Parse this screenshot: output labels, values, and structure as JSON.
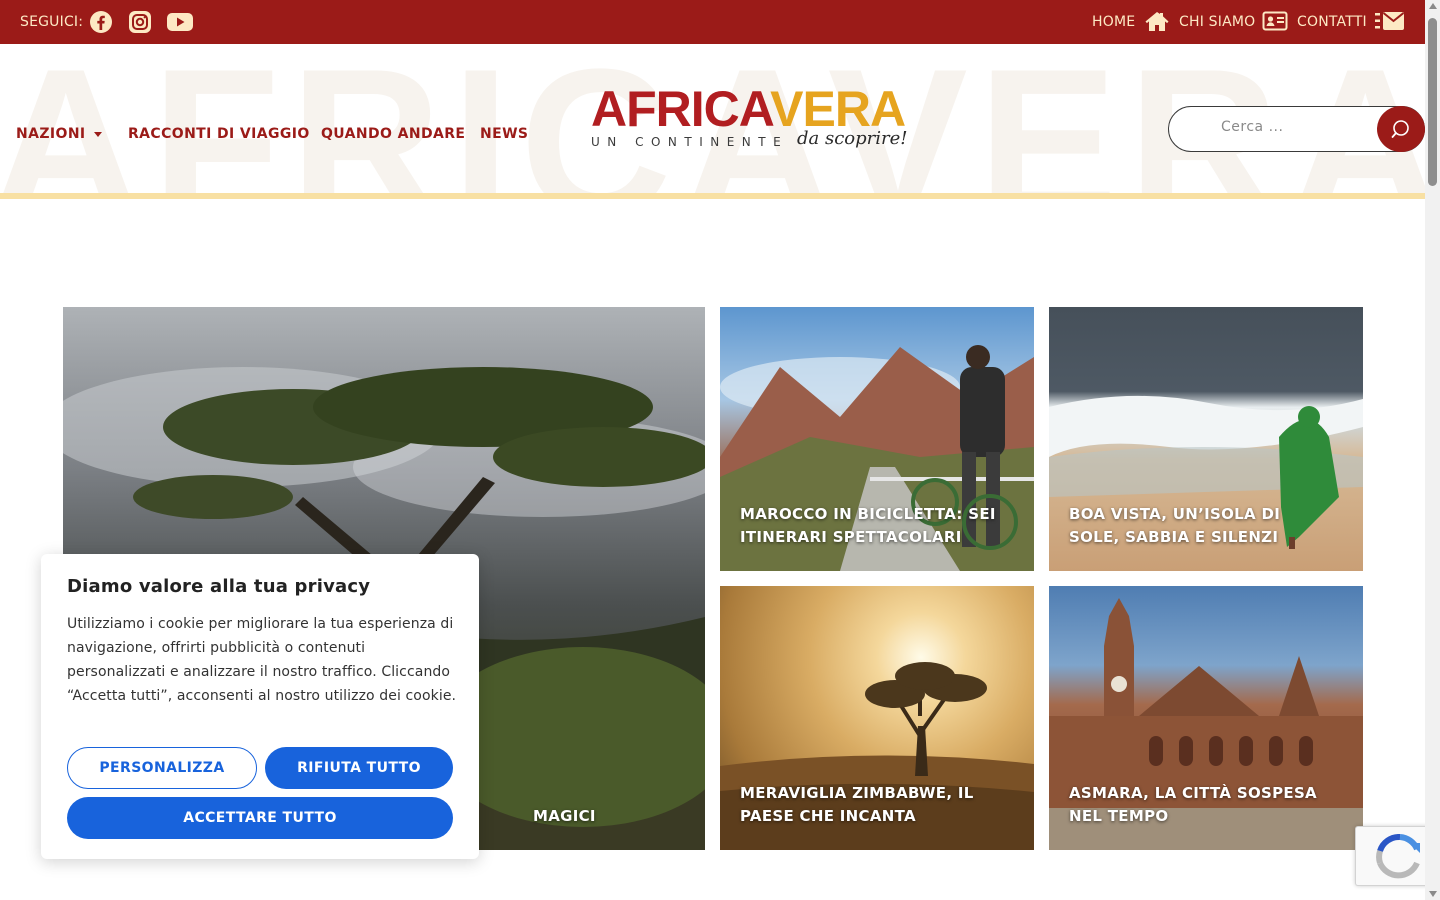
{
  "topbar": {
    "follow_label": "SEGUICI:",
    "social": [
      "facebook-icon",
      "instagram-icon",
      "youtube-icon"
    ],
    "links": [
      {
        "label": "HOME",
        "icon": "home-icon"
      },
      {
        "label": "CHI SIAMO",
        "icon": "id-card-icon"
      },
      {
        "label": "CONTATTI",
        "icon": "envelope-icon"
      }
    ]
  },
  "header": {
    "watermark": "AFRICAVERA AFRICAVERA",
    "nav": [
      {
        "label": "NAZIONI",
        "has_dropdown": true
      },
      {
        "label": "RACCONTI DI VIAGGIO"
      },
      {
        "label": "QUANDO ANDARE"
      },
      {
        "label": "NEWS"
      }
    ],
    "logo": {
      "part1": "AFRICA",
      "part2": "VERA",
      "tagline": "UN CONTINENTE",
      "script": "da scoprire!"
    },
    "search": {
      "placeholder": "Cerca ..."
    }
  },
  "articles": [
    {
      "title": "MAGICI"
    },
    {
      "title": "MAROCCO IN BICICLETTA: SEI ITINERARI SPETTACOLARI"
    },
    {
      "title": "BOA VISTA, UN’ISOLA DI SOLE, SABBIA E SILENZI"
    },
    {
      "title": "MERAVIGLIA ZIMBABWE, IL PAESE CHE INCANTA"
    },
    {
      "title": "ASMARA, LA CITTÀ SOSPESA NEL TEMPO"
    }
  ],
  "cookie": {
    "title": "Diamo valore alla tua privacy",
    "text": "Utilizziamo i cookie per migliorare la tua esperienza di navigazione, offrirti pubblicità o contenuti personalizzati e analizzare il nostro traffico. Cliccando “Accetta tutti”, acconsenti al nostro utilizzo dei cookie.",
    "customize": "PERSONALIZZA",
    "reject": "RIFIUTA TUTTO",
    "accept": "ACCETTARE TUTTO"
  },
  "colors": {
    "brand_red": "#9b1b18",
    "brand_gold": "#e6a41f",
    "cookie_blue": "#1863dc"
  }
}
